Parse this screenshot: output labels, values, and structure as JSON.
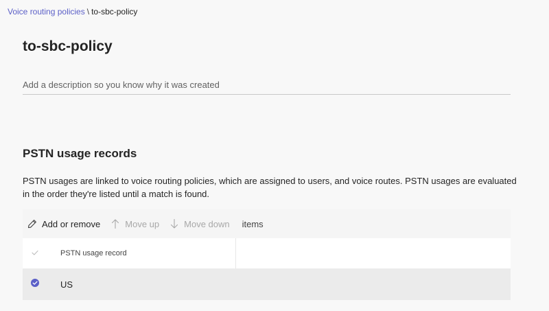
{
  "breadcrumb": {
    "parent": "Voice routing policies",
    "separator": "\\",
    "current": "to-sbc-policy"
  },
  "page": {
    "title": "to-sbc-policy",
    "description_value": "",
    "description_placeholder": "Add a description so you know why it was created"
  },
  "pstn_section": {
    "heading": "PSTN usage records",
    "description": "PSTN usages are linked to voice routing policies, which are assigned to users, and voice routes. PSTN usages are evaluated in the order they're listed until a match is found."
  },
  "toolbar": {
    "add_remove_label": "Add or remove",
    "add_remove_icon": "pencil-icon",
    "move_up_label": "Move up",
    "move_up_icon": "arrow-up-icon",
    "move_down_label": "Move down",
    "move_down_icon": "arrow-down-icon",
    "items_label": "items"
  },
  "table": {
    "columns": [
      "PSTN usage record"
    ],
    "rows": [
      {
        "value": "US",
        "selected": true
      }
    ]
  },
  "colors": {
    "accent": "#5b5fc7",
    "background": "#f8f8f8",
    "selected_row": "#ebebeb",
    "disabled_text": "#a8a8a8"
  }
}
